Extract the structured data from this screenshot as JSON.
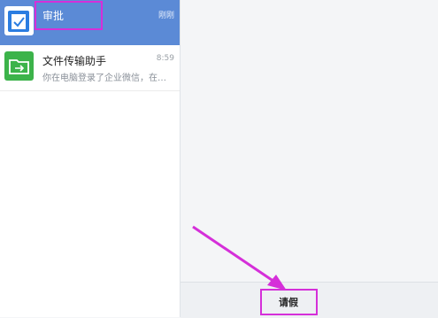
{
  "chat_list": [
    {
      "name": "审批",
      "time": "刚刚",
      "preview": "",
      "icon": "approval-check-icon",
      "active": true
    },
    {
      "name": "文件传输助手",
      "time": "8:59",
      "preview": "你在电脑登录了企业微信，在…",
      "icon": "folder-transfer-icon",
      "active": false
    }
  ],
  "bottom_bar": {
    "leave_label": "请假"
  },
  "colors": {
    "active_bg": "#5b8ad6",
    "highlight": "#d52fd9",
    "folder_green": "#3cb34a",
    "approval_blue": "#2b7de1"
  }
}
